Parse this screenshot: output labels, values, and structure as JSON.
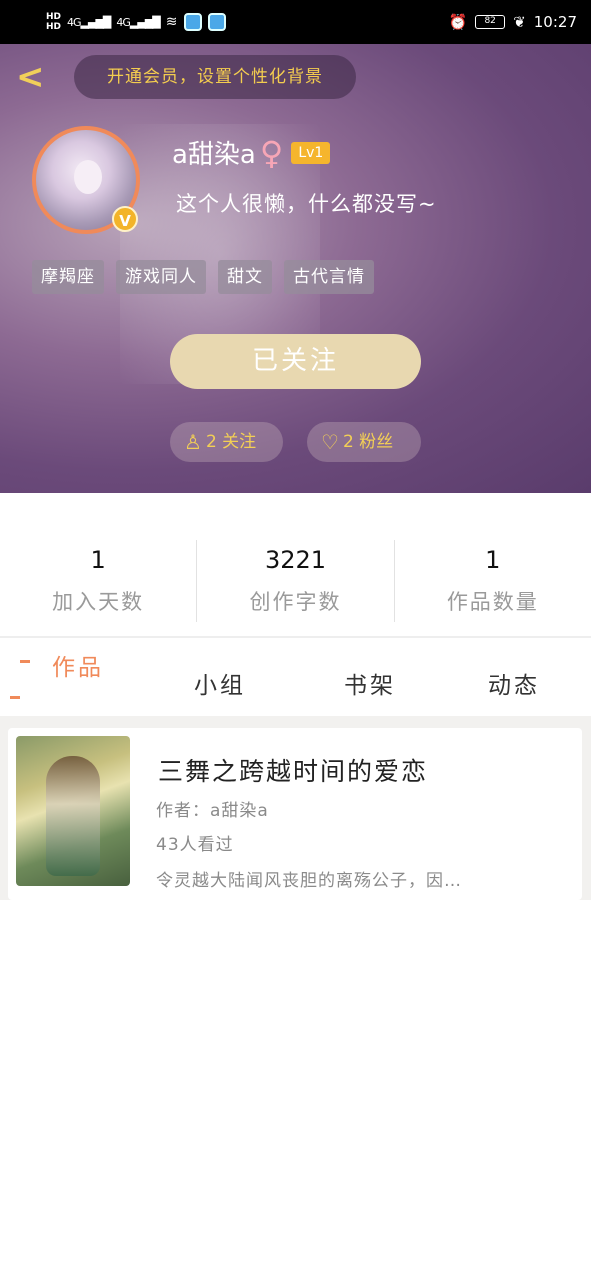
{
  "status_bar": {
    "network_left": "HD",
    "signal_1": "4G",
    "signal_2": "4G",
    "battery": "82",
    "time": "10:27"
  },
  "header": {
    "back_icon": "chevron-left-icon",
    "vip_banner": "开通会员，设置个性化背景"
  },
  "profile": {
    "username": "a甜染a",
    "gender_icon": "♀",
    "level": "Lv1",
    "vip_badge": "V",
    "signature": "这个人很懒，什么都没写~",
    "tags": [
      "摩羯座",
      "游戏同人",
      "甜文",
      "古代言情"
    ],
    "follow_button": "已关注",
    "following_label": "2 关注",
    "fans_label": "2 粉丝"
  },
  "stats": [
    {
      "value": "1",
      "label": "加入天数"
    },
    {
      "value": "3221",
      "label": "创作字数"
    },
    {
      "value": "1",
      "label": "作品数量"
    }
  ],
  "tabs": {
    "works": "作品",
    "group": "小组",
    "shelf": "书架",
    "dynamic": "动态"
  },
  "works": [
    {
      "title": "三舞之跨越时间的爱恋",
      "author": "作者：a甜染a",
      "views": "43人看过",
      "description": "令灵越大陆闻风丧胆的离殇公子，因…"
    }
  ],
  "colors": {
    "accent_orange": "#f08a5a",
    "gold": "#f3cf55",
    "follow_button_bg": "#e8d8b0",
    "level_badge": "#f5b52d"
  }
}
